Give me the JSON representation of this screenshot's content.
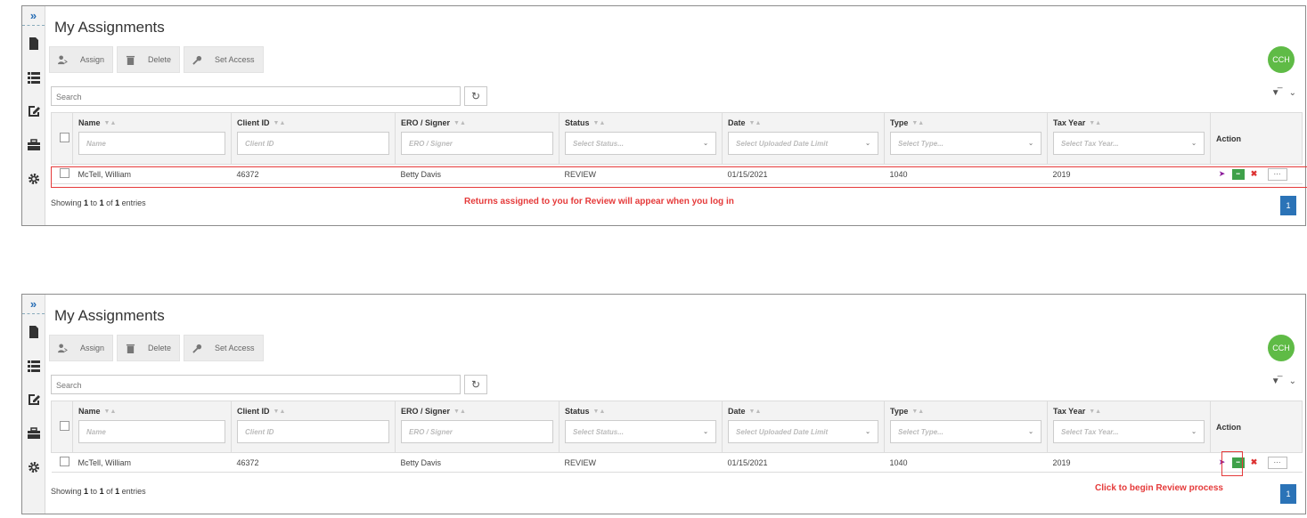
{
  "panels": [
    {
      "title": "My Assignments",
      "toolbar": {
        "assign": "Assign",
        "delete": "Delete",
        "set_access": "Set Access"
      },
      "avatar": "CCH",
      "search_placeholder": "Search",
      "columns": [
        {
          "label": "Name",
          "filter": "Name"
        },
        {
          "label": "Client ID",
          "filter": "Client ID"
        },
        {
          "label": "ERO / Signer",
          "filter": "ERO / Signer"
        },
        {
          "label": "Status",
          "filter": "Select Status..."
        },
        {
          "label": "Date",
          "filter": "Select Uploaded Date Limit"
        },
        {
          "label": "Type",
          "filter": "Select Type..."
        },
        {
          "label": "Tax Year",
          "filter": "Select Tax Year..."
        },
        {
          "label": "Action"
        }
      ],
      "row": {
        "name": "McTell, William",
        "client_id": "46372",
        "ero": "Betty Davis",
        "status": "REVIEW",
        "date": "01/15/2021",
        "type": "1040",
        "tax_year": "2019",
        "more": "···"
      },
      "showing": {
        "pre": "Showing ",
        "from": "1",
        "mid1": " to ",
        "to": "1",
        "mid2": " of ",
        "total": "1",
        "post": " entries"
      },
      "note": "Returns assigned to you for Review will appear when you log in",
      "page": "1"
    },
    {
      "title": "My Assignments",
      "toolbar": {
        "assign": "Assign",
        "delete": "Delete",
        "set_access": "Set Access"
      },
      "avatar": "CCH",
      "search_placeholder": "Search",
      "columns": [
        {
          "label": "Name",
          "filter": "Name"
        },
        {
          "label": "Client ID",
          "filter": "Client ID"
        },
        {
          "label": "ERO / Signer",
          "filter": "ERO / Signer"
        },
        {
          "label": "Status",
          "filter": "Select Status..."
        },
        {
          "label": "Date",
          "filter": "Select Uploaded Date Limit"
        },
        {
          "label": "Type",
          "filter": "Select Type..."
        },
        {
          "label": "Tax Year",
          "filter": "Select Tax Year..."
        },
        {
          "label": "Action"
        }
      ],
      "row": {
        "name": "McTell, William",
        "client_id": "46372",
        "ero": "Betty Davis",
        "status": "REVIEW",
        "date": "01/15/2021",
        "type": "1040",
        "tax_year": "2019",
        "more": "···"
      },
      "showing": {
        "pre": "Showing ",
        "from": "1",
        "mid1": " to ",
        "to": "1",
        "mid2": " of ",
        "total": "1",
        "post": " entries"
      },
      "note": "Click to begin Review process",
      "page": "1"
    }
  ],
  "sidebar": {
    "expand": "»",
    "icons": [
      "document-icon",
      "list-icon",
      "edit-icon",
      "briefcase-icon",
      "gear-icon"
    ]
  },
  "colors": {
    "accent": "#2b73b7",
    "highlight": "#e53a3a",
    "avatar": "#5fbb46",
    "review_icon": "#8b1a9b"
  }
}
